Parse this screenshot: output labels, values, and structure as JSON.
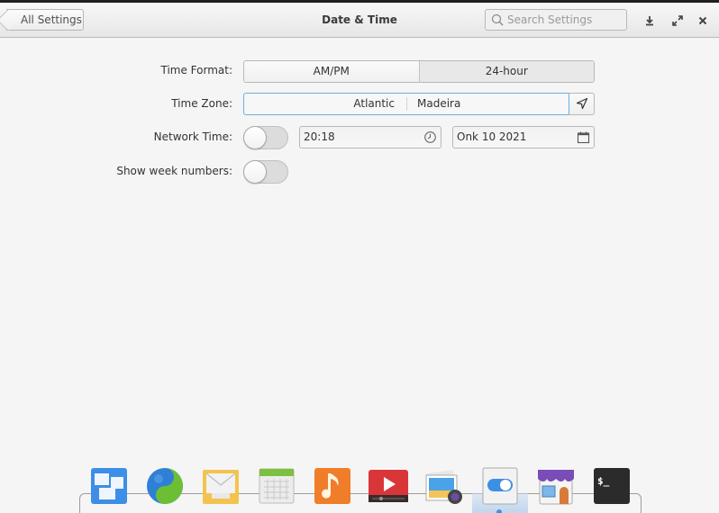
{
  "window": {
    "title": "Date & Time",
    "back_button": "All Settings",
    "search_placeholder": "Search Settings",
    "controls": [
      "download-icon",
      "maximize-icon",
      "close-icon"
    ]
  },
  "settings": {
    "time_format": {
      "label": "Time Format:",
      "options": [
        "AM/PM",
        "24-hour"
      ],
      "selected": "24-hour"
    },
    "time_zone": {
      "label": "Time Zone:",
      "continent": "Atlantic",
      "city": "Madeira"
    },
    "network_time": {
      "label": "Network Time:",
      "enabled": false,
      "time_value": "20:18",
      "date_value": "Onk 10 2021"
    },
    "week_numbers": {
      "label": "Show week numbers:",
      "enabled": false
    }
  },
  "dock": {
    "items": [
      {
        "name": "multitasking-view",
        "icon": "multitasking-icon"
      },
      {
        "name": "web-browser",
        "icon": "browser-icon"
      },
      {
        "name": "mail",
        "icon": "mail-icon"
      },
      {
        "name": "calendar",
        "icon": "calendar-icon"
      },
      {
        "name": "music",
        "icon": "music-icon"
      },
      {
        "name": "videos",
        "icon": "videos-icon"
      },
      {
        "name": "photos",
        "icon": "photos-icon"
      },
      {
        "name": "system-settings",
        "icon": "settings-icon",
        "active": true
      },
      {
        "name": "appcenter",
        "icon": "appcenter-icon"
      },
      {
        "name": "terminal",
        "icon": "terminal-icon"
      }
    ]
  }
}
